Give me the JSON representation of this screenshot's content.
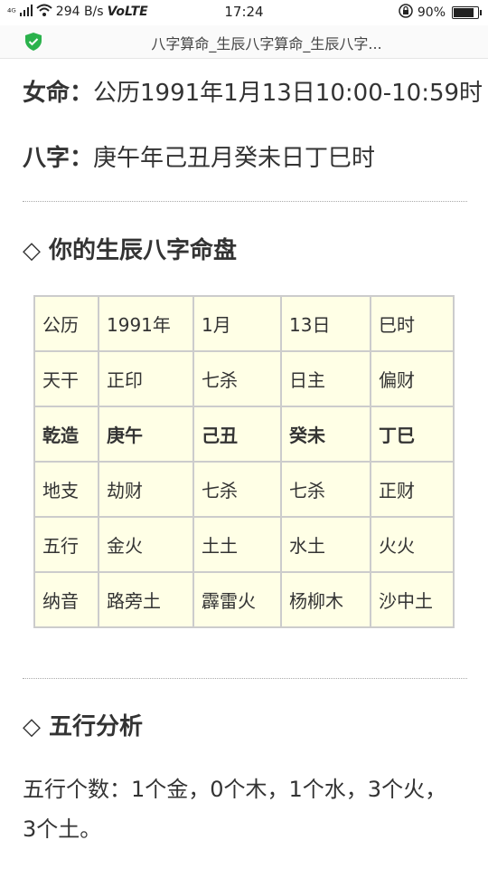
{
  "status_bar": {
    "network": "⁴ᴳ",
    "speed": "294 B/s",
    "volte": "VoLTE",
    "time": "17:24",
    "battery": "90%",
    "battery_level": 0.9
  },
  "address_bar": {
    "title": "八字算命_生辰八字算命_生辰八字..."
  },
  "info": {
    "gender_label": "女命：",
    "date_value": "公历1991年1月13日10:00-10:59时",
    "bazi_label": "八字：",
    "bazi_value": "庚午年己丑月癸未日丁巳时"
  },
  "sections": {
    "chart_heading": "◇ 你的生辰八字命盘",
    "wuxing_heading": "◇ 五行分析"
  },
  "table": {
    "rows": [
      [
        "公历",
        "1991年",
        "1月",
        "13日",
        "巳时"
      ],
      [
        "天干",
        "正印",
        "七杀",
        "日主",
        "偏财"
      ],
      [
        "乾造",
        "庚午",
        "己丑",
        "癸未",
        "丁巳"
      ],
      [
        "地支",
        "劫财",
        "七杀",
        "七杀",
        "正财"
      ],
      [
        "五行",
        "金火",
        "土土",
        "水土",
        "火火"
      ],
      [
        "纳音",
        "路旁土",
        "霹雷火",
        "杨柳木",
        "沙中土"
      ]
    ]
  },
  "wuxing_summary": "五行个数：1个金，0个木，1个水，3个火，3个土。",
  "colors": {
    "table_background": "#ffffe6",
    "table_border": "#cccccc",
    "shield_green": "#2bb24c"
  }
}
